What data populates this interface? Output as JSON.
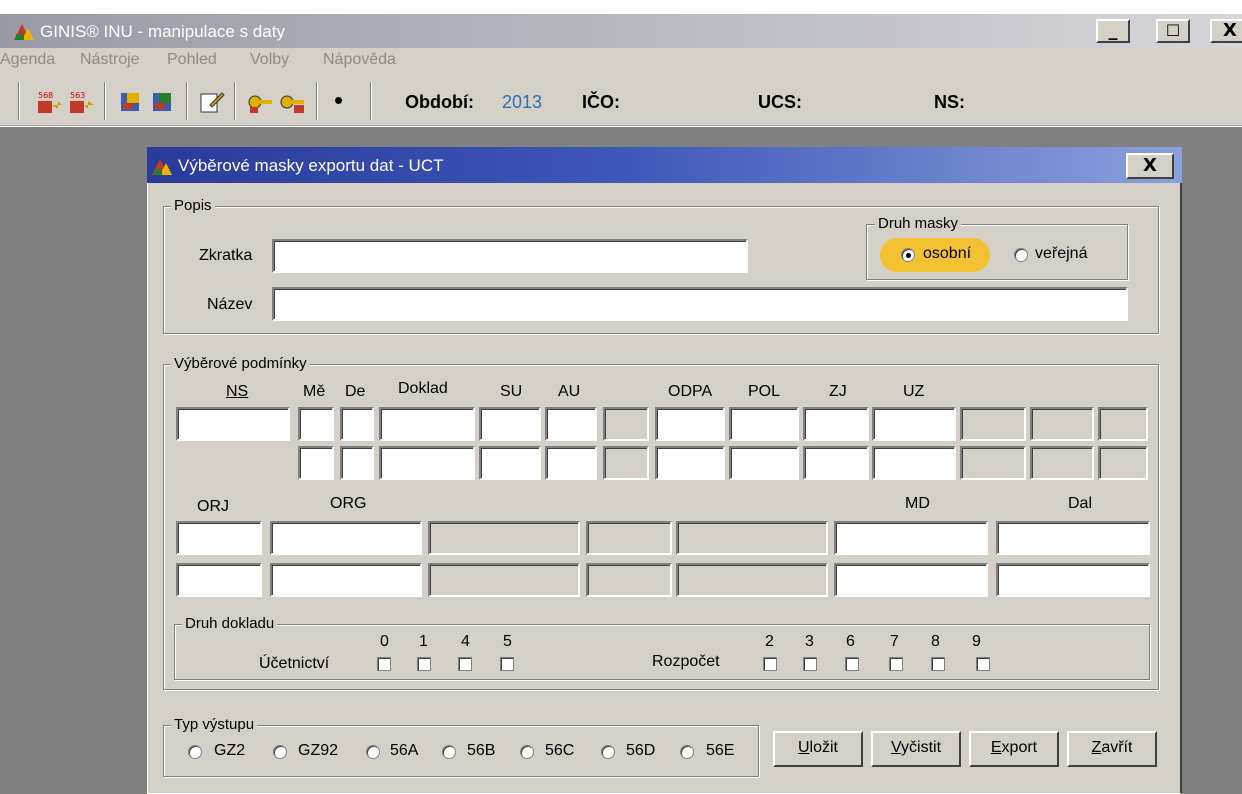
{
  "window": {
    "title": "GINIS® INU - manipulace s daty",
    "controls": [
      "_",
      "☐",
      "X"
    ]
  },
  "menu": [
    "Agenda",
    "Nástroje",
    "Pohled",
    "Volby",
    "Nápověda"
  ],
  "toolbar": {
    "obdobi_label": "Období:",
    "obdobi_value": "2013",
    "ico_label": "IČO:",
    "ucs_label": "UCS:",
    "ns_label": "NS:",
    "bullet": "•",
    "colors": {
      "obdobi_value": "#2f6fb4"
    }
  },
  "dialog": {
    "title": "Výběrové masky exportu dat - UCT",
    "close": "X",
    "popis": {
      "title": "Popis",
      "zkratka_label": "Zkratka",
      "zkratka_value": "",
      "nazev_label": "Název",
      "nazev_value": ""
    },
    "druh_masky": {
      "title": "Druh masky",
      "options": [
        {
          "label": "osobní",
          "selected": true
        },
        {
          "label": "veřejná",
          "selected": false
        }
      ]
    },
    "podminky": {
      "title": "Výběrové podmínky",
      "headers": {
        "ns": "NS",
        "me": "Mě",
        "de": "De",
        "doklad": "Doklad",
        "su": "SU",
        "au": "AU",
        "odpa": "ODPA",
        "pol": "POL",
        "zj": "ZJ",
        "uz": "UZ",
        "orj": "ORJ",
        "org": "ORG",
        "md": "MD",
        "dal": "Dal"
      }
    },
    "druh_dokladu": {
      "title": "Druh dokladu",
      "ucetnictvi_label": "Účetnictví",
      "ucetnictvi_digits": [
        "0",
        "1",
        "4",
        "5"
      ],
      "rozpocet_label": "Rozpočet",
      "rozpocet_digits": [
        "2",
        "3",
        "6",
        "7",
        "8",
        "9"
      ]
    },
    "typ_vystupu": {
      "title": "Typ výstupu",
      "options": [
        "GZ2",
        "GZ92",
        "56A",
        "56B",
        "56C",
        "56D",
        "56E"
      ]
    },
    "buttons": [
      {
        "key": "U",
        "rest": "ložit"
      },
      {
        "key": "V",
        "rest": "yčistit"
      },
      {
        "key": "E",
        "rest": "xport"
      },
      {
        "key": "Z",
        "rest": "avřít"
      }
    ]
  }
}
